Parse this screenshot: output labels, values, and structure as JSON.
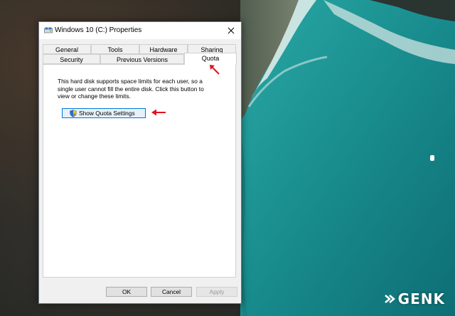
{
  "window": {
    "title": "Windows 10 (C:) Properties"
  },
  "tabs_row1": [
    "General",
    "Tools",
    "Hardware",
    "Sharing"
  ],
  "tabs_row2": [
    "Security",
    "Previous Versions",
    "Quota"
  ],
  "active_tab": "Quota",
  "quota": {
    "description": "This hard disk supports space limits for each user, so a single user cannot fill the entire disk. Click this button to view or change these limits.",
    "button_label": "Show Quota Settings"
  },
  "buttons": {
    "ok": "OK",
    "cancel": "Cancel",
    "apply": "Apply"
  },
  "watermark": "GENK",
  "colors": {
    "annotation_arrow": "#e0141c",
    "button_focus": "#0078d7"
  }
}
